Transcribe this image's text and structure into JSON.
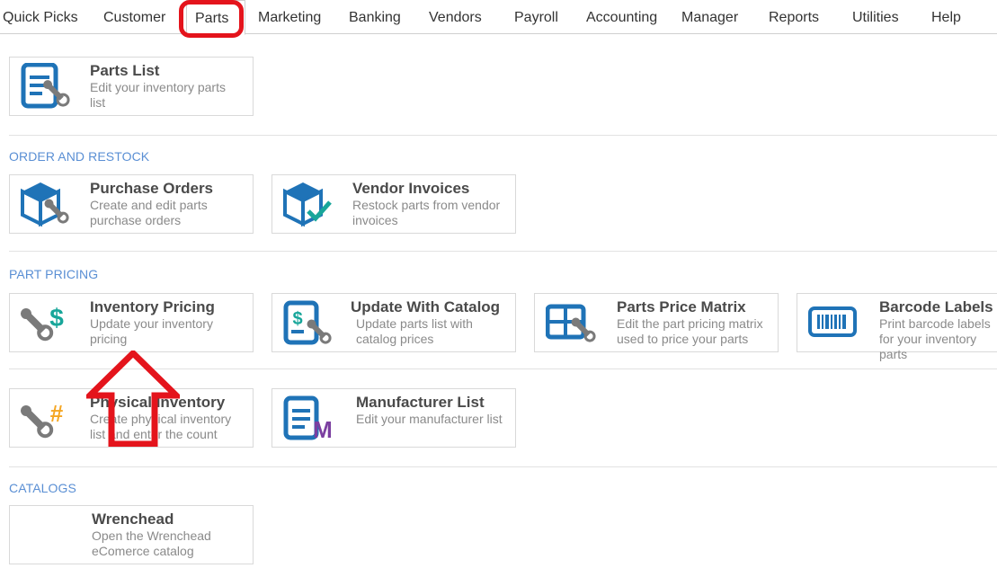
{
  "nav": {
    "items": [
      "Quick Picks",
      "Customer",
      "Parts",
      "Marketing",
      "Banking",
      "Vendors",
      "Payroll",
      "Accounting",
      "Manager",
      "Reports",
      "Utilities",
      "Help"
    ],
    "active": "Parts"
  },
  "sections": {
    "order_restock": "ORDER AND RESTOCK",
    "part_pricing": "PART PRICING",
    "catalogs": "CATALOGS"
  },
  "cards": {
    "parts_list": {
      "title": "Parts List",
      "desc": "Edit your inventory parts list"
    },
    "purchase_orders": {
      "title": "Purchase Orders",
      "desc": "Create and edit parts purchase orders"
    },
    "vendor_invoices": {
      "title": "Vendor Invoices",
      "desc": "Restock parts from vendor invoices"
    },
    "inventory_pricing": {
      "title": "Inventory Pricing",
      "desc": "Update your inventory pricing"
    },
    "update_catalog": {
      "title": "Update With Catalog",
      "desc": "Update parts list with catalog prices"
    },
    "price_matrix": {
      "title": "Parts Price Matrix",
      "desc": "Edit the part pricing matrix used to price your parts"
    },
    "barcode_labels": {
      "title": "Barcode Labels",
      "desc": "Print barcode labels for your inventory parts"
    },
    "physical_inventory": {
      "title": "Physical Inventory",
      "desc": "Create physical inventory list and enter the count"
    },
    "manufacturer_list": {
      "title": "Manufacturer List",
      "desc": "Edit your manufacturer list"
    },
    "wrenchead": {
      "title": "Wrenchead",
      "desc": "Open the Wrenchead eComerce catalog"
    }
  },
  "colors": {
    "brand_blue": "#1f73b7",
    "teal": "#18a69a",
    "gray_icon": "#7a7a7a",
    "orange": "#f5a623",
    "purple": "#7b3fa0",
    "highlight_red": "#e4141c",
    "section_blue": "#5a8fd4"
  },
  "icons": {
    "parts_list": "document-wrench-icon",
    "purchase_orders": "box-wrench-icon",
    "vendor_invoices": "box-check-icon",
    "inventory_pricing": "wrench-dollar-icon",
    "update_catalog": "document-dollar-icon",
    "price_matrix": "grid-wrench-icon",
    "barcode_labels": "barcode-icon",
    "physical_inventory": "wrench-hash-icon",
    "manufacturer_list": "document-m-icon"
  }
}
